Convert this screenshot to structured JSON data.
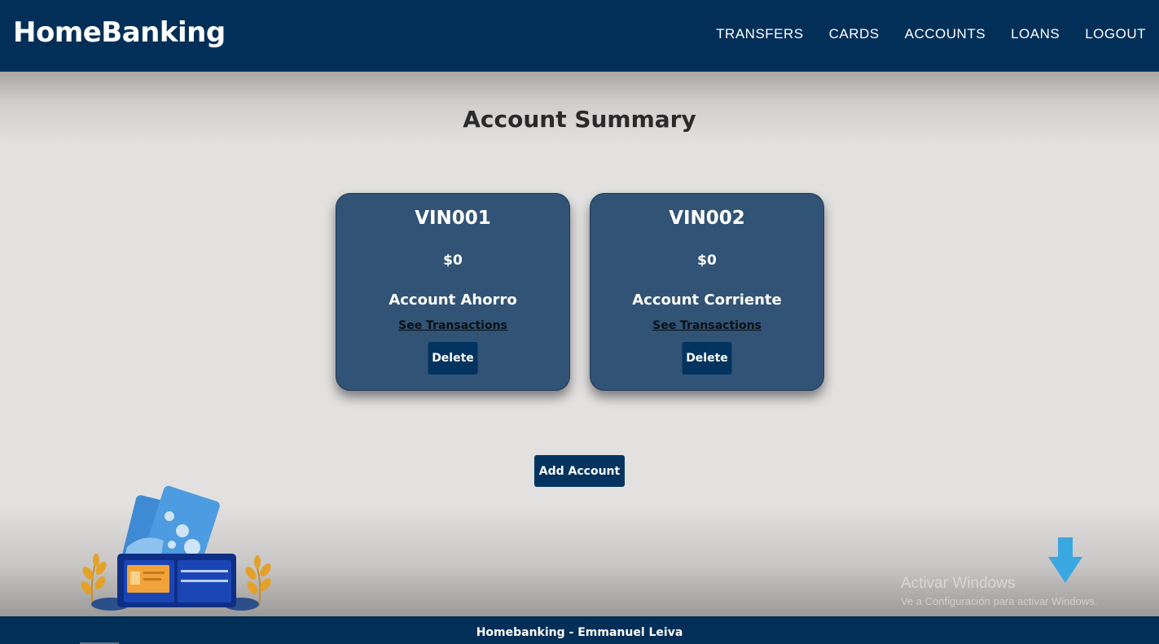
{
  "navbar": {
    "brand": "HomeBanking",
    "links": [
      "TRANSFERS",
      "CARDS",
      "ACCOUNTS",
      "LOANS",
      "LOGOUT"
    ]
  },
  "main": {
    "title": "Account Summary",
    "accounts": [
      {
        "number": "VIN001",
        "balance": "$0",
        "type": "Account Ahorro",
        "link": "See Transactions",
        "delete_label": "Delete"
      },
      {
        "number": "VIN002",
        "balance": "$0",
        "type": "Account Corriente",
        "link": "See Transactions",
        "delete_label": "Delete"
      }
    ],
    "add_label": "Add Account"
  },
  "overlay": {
    "activation_title": "Activar Windows",
    "activation_sub": "Ve a Configuración para activar Windows."
  },
  "footer": {
    "text": "Homebanking - Emmanuel Leiva"
  },
  "colors": {
    "navbar": "#022f58",
    "card": "#315375",
    "button": "#02345f",
    "background": "#e2e1e0"
  }
}
